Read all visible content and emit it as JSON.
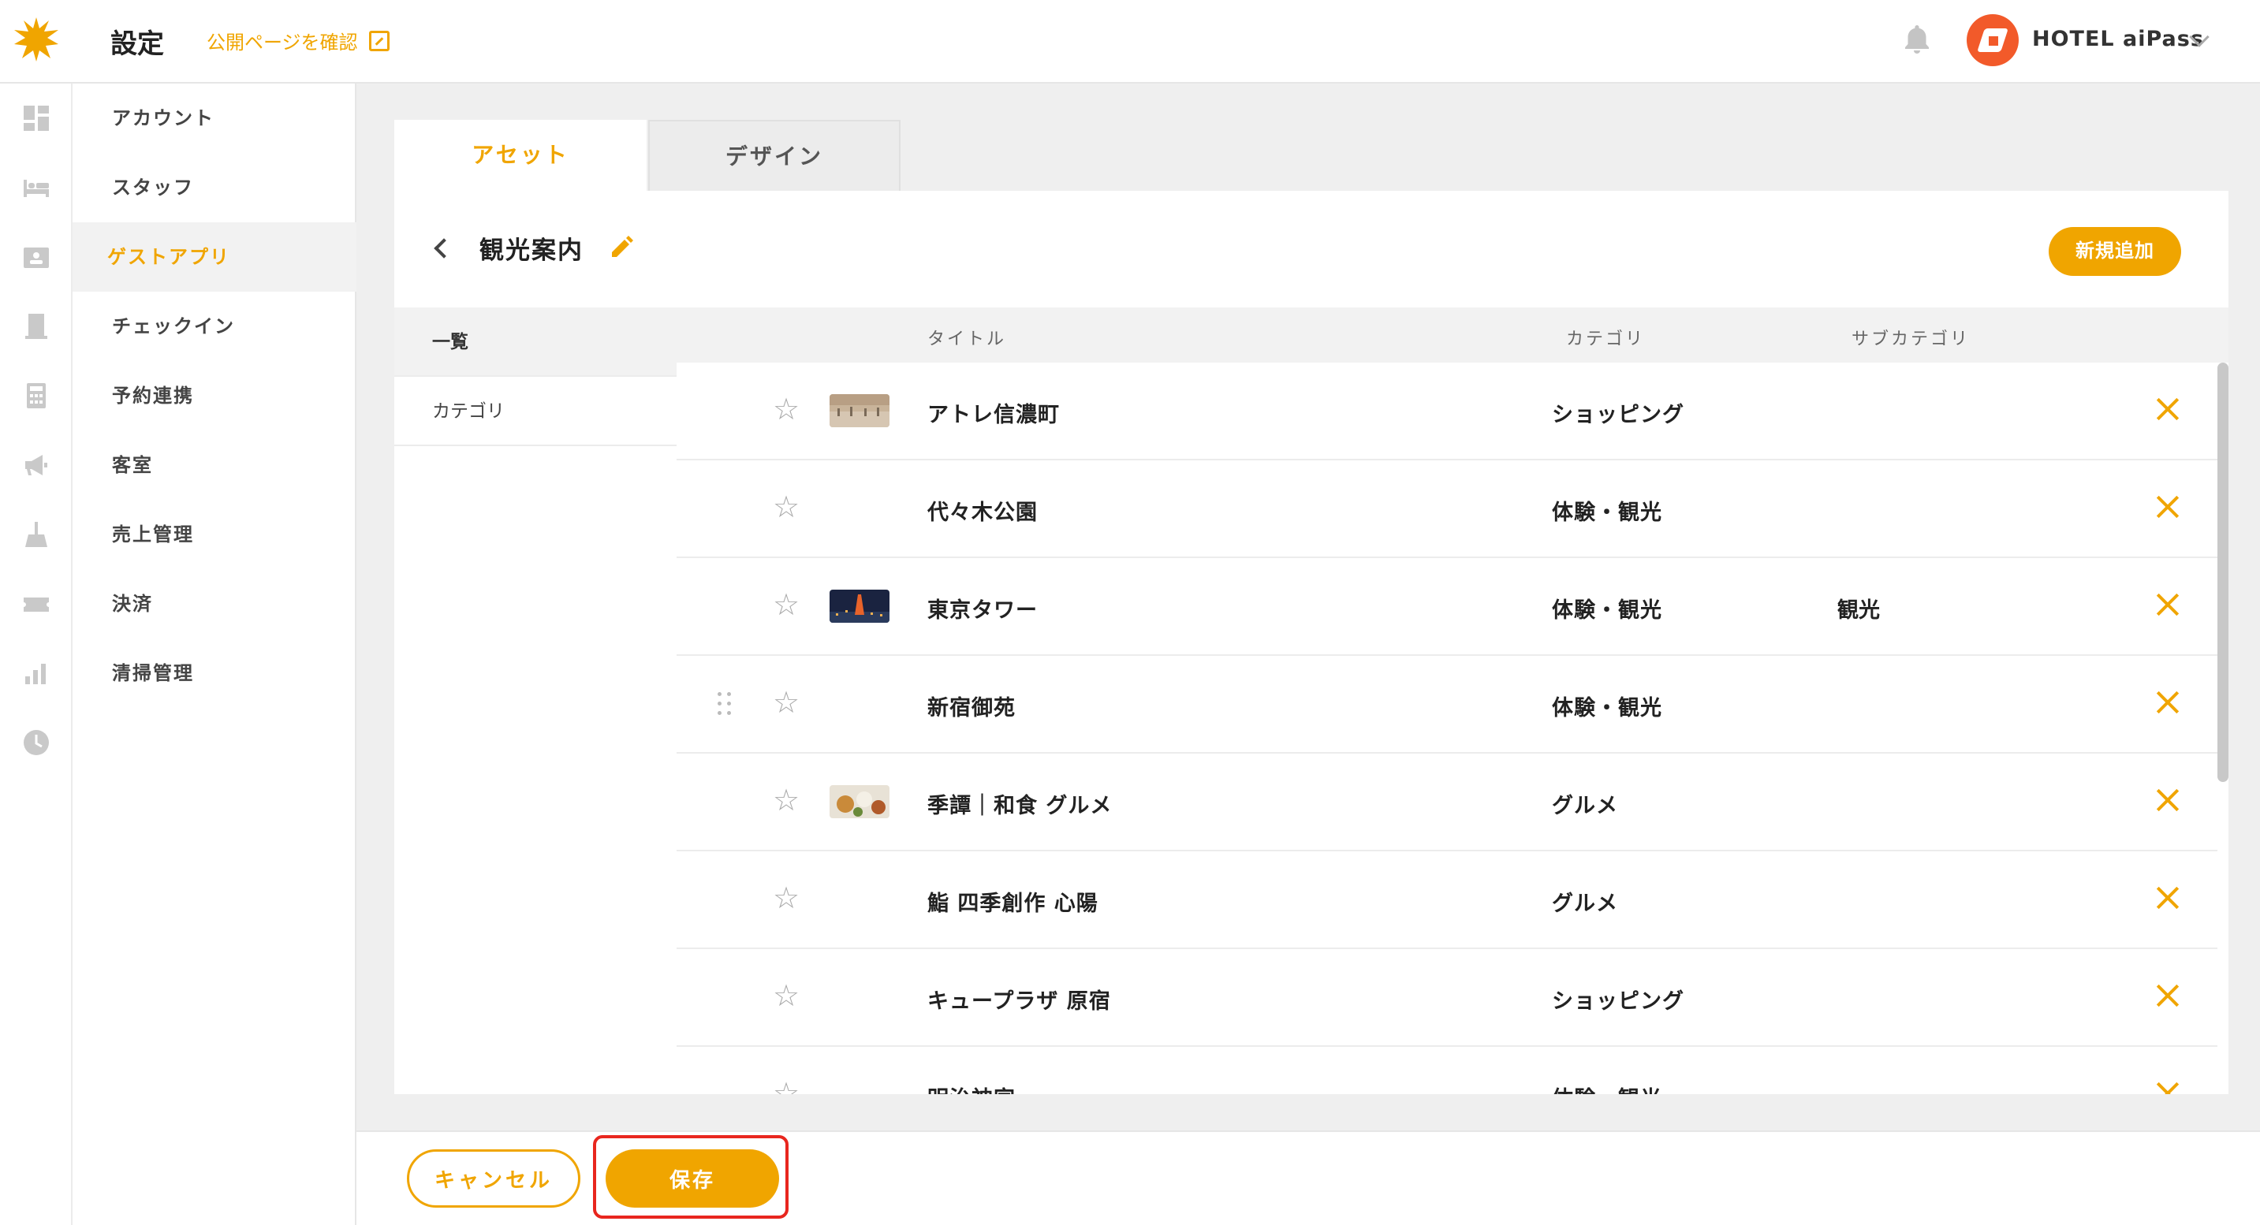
{
  "header": {
    "title": "設定",
    "public_link": "公開ページを確認",
    "hotel_name": "HOTEL aiPass"
  },
  "rail_icons": [
    "dashboard-icon",
    "bed-icon",
    "contacts-icon",
    "building-icon",
    "calculator-icon",
    "megaphone-icon",
    "cleaning-icon",
    "ticket-icon",
    "bar-chart-icon",
    "clock-icon"
  ],
  "settings_nav": [
    {
      "label": "アカウント"
    },
    {
      "label": "スタッフ"
    },
    {
      "label": "ゲストアプリ",
      "active": true
    },
    {
      "label": "チェックイン"
    },
    {
      "label": "予約連携"
    },
    {
      "label": "客室"
    },
    {
      "label": "売上管理"
    },
    {
      "label": "決済"
    },
    {
      "label": "清掃管理"
    }
  ],
  "tabs": [
    {
      "label": "アセット",
      "active": true
    },
    {
      "label": "デザイン"
    }
  ],
  "section": {
    "title": "観光案内",
    "add_label": "新規追加"
  },
  "subnav": [
    {
      "label": "一覧",
      "active": true
    },
    {
      "label": "カテゴリ"
    }
  ],
  "table": {
    "columns": [
      "タイトル",
      "カテゴリ",
      "サブカテゴリ"
    ],
    "rows": [
      {
        "title": "アトレ信濃町",
        "category": "ショッピング",
        "subcategory": "",
        "image": "street"
      },
      {
        "title": "代々木公園",
        "category": "体験・観光",
        "subcategory": "",
        "image": ""
      },
      {
        "title": "東京タワー",
        "category": "体験・観光",
        "subcategory": "観光",
        "image": "night"
      },
      {
        "title": "新宿御苑",
        "category": "体験・観光",
        "subcategory": "",
        "image": ""
      },
      {
        "title": "季譚｜和食 グルメ",
        "category": "グルメ",
        "subcategory": "",
        "image": "food"
      },
      {
        "title": "鮨 四季創作 心陽",
        "category": "グルメ",
        "subcategory": "",
        "image": ""
      },
      {
        "title": "キュープラザ 原宿",
        "category": "ショッピング",
        "subcategory": "",
        "image": ""
      },
      {
        "title": "明治神宮",
        "category": "体験・観光",
        "subcategory": "",
        "image": ""
      }
    ]
  },
  "footer": {
    "cancel_label": "キャンセル",
    "save_label": "保存"
  },
  "colors": {
    "accent": "#f0a500",
    "highlight": "#e8261e",
    "hotel_logo": "#f25a2a"
  }
}
